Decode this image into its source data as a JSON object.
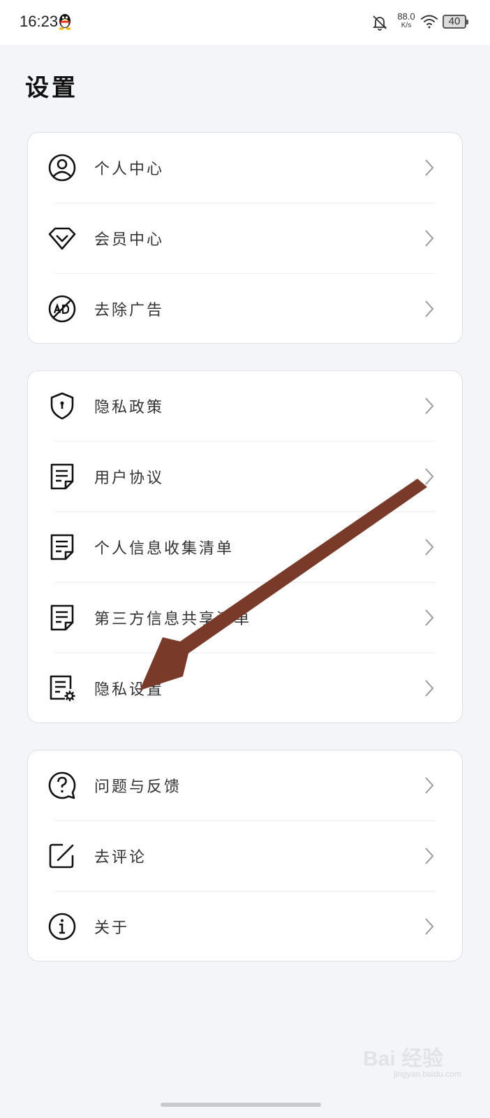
{
  "status_bar": {
    "time": "16:23",
    "net_speed_value": "88.0",
    "net_speed_unit": "K/s",
    "battery": "40",
    "icons": [
      "qq-icon",
      "bell-off-icon",
      "wifi-icon",
      "battery-icon"
    ]
  },
  "page": {
    "title": "设置"
  },
  "sections": [
    {
      "items": [
        {
          "label": "个人中心",
          "icon": "user-circle-icon"
        },
        {
          "label": "会员中心",
          "icon": "vip-diamond-icon"
        },
        {
          "label": "去除广告",
          "icon": "no-ads-icon"
        }
      ]
    },
    {
      "items": [
        {
          "label": "隐私政策",
          "icon": "shield-icon"
        },
        {
          "label": "用户协议",
          "icon": "document-icon"
        },
        {
          "label": "个人信息收集清单",
          "icon": "document-icon"
        },
        {
          "label": "第三方信息共享清单",
          "icon": "document-icon"
        },
        {
          "label": "隐私设置",
          "icon": "document-settings-icon"
        }
      ]
    },
    {
      "items": [
        {
          "label": "问题与反馈",
          "icon": "question-bubble-icon"
        },
        {
          "label": "去评论",
          "icon": "edit-icon"
        },
        {
          "label": "关于",
          "icon": "info-icon"
        }
      ]
    }
  ],
  "annotation": {
    "color": "#7a3a2a",
    "points_to": "隐私设置"
  },
  "watermark": {
    "text": "Bai 经验",
    "sub": "jingyan.baidu.com"
  }
}
